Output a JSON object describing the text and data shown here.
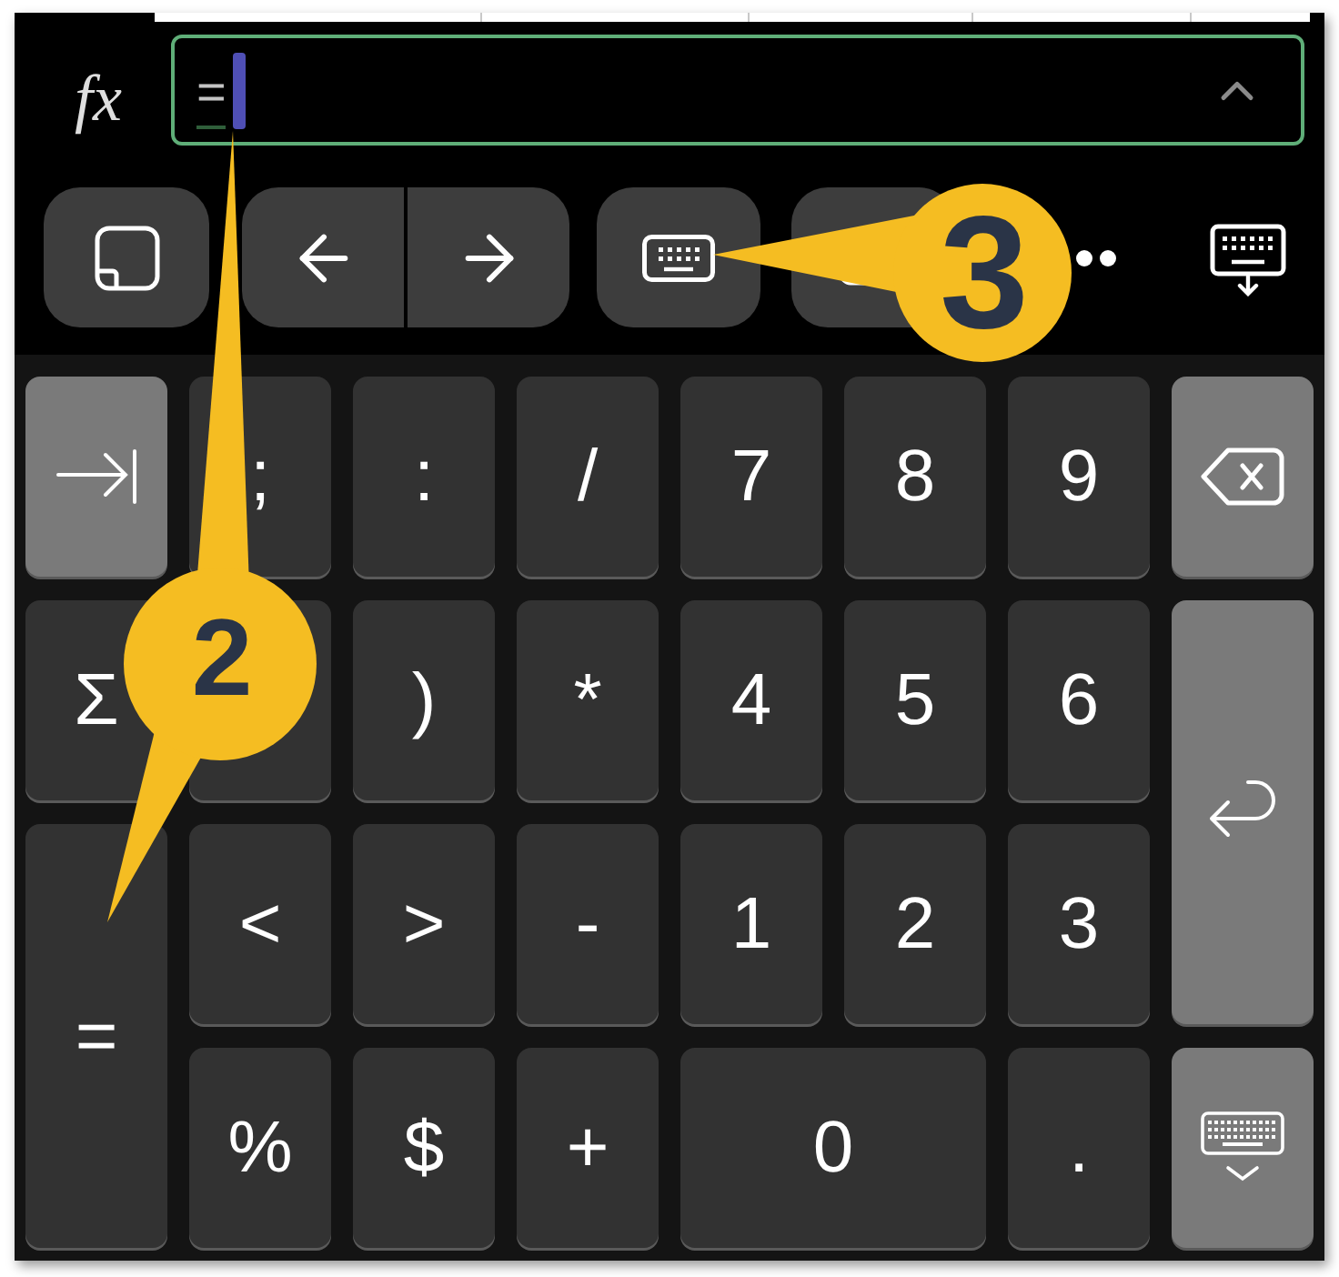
{
  "formula_bar": {
    "function_label": "fx",
    "value": "=",
    "focused": true
  },
  "keys": [
    {
      "kind": "tab"
    },
    {
      "kind": "char",
      "label": ";"
    },
    {
      "kind": "char",
      "label": ":"
    },
    {
      "kind": "char",
      "label": "/"
    },
    {
      "kind": "char",
      "label": "7"
    },
    {
      "kind": "char",
      "label": "8"
    },
    {
      "kind": "char",
      "label": "9"
    },
    {
      "kind": "backspace"
    },
    {
      "kind": "char",
      "label": "Σ"
    },
    {
      "kind": "char"
    },
    {
      "kind": "char",
      "label": ")"
    },
    {
      "kind": "char",
      "label": "*"
    },
    {
      "kind": "char",
      "label": "4"
    },
    {
      "kind": "char",
      "label": "5"
    },
    {
      "kind": "char",
      "label": "6"
    },
    {
      "kind": "enter"
    },
    {
      "kind": "char",
      "label": "="
    },
    {
      "kind": "char",
      "label": "<"
    },
    {
      "kind": "char",
      "label": ">"
    },
    {
      "kind": "char",
      "label": "-"
    },
    {
      "kind": "char",
      "label": "1"
    },
    {
      "kind": "char",
      "label": "2"
    },
    {
      "kind": "char",
      "label": "3"
    },
    {
      "kind": "char",
      "label": "%"
    },
    {
      "kind": "char",
      "label": "$"
    },
    {
      "kind": "char",
      "label": "+"
    },
    {
      "kind": "char",
      "label": "0"
    },
    {
      "kind": "char",
      "label": "."
    },
    {
      "kind": "hide_keyboard"
    }
  ],
  "callouts": [
    {
      "number": "2"
    },
    {
      "number": "3"
    }
  ]
}
